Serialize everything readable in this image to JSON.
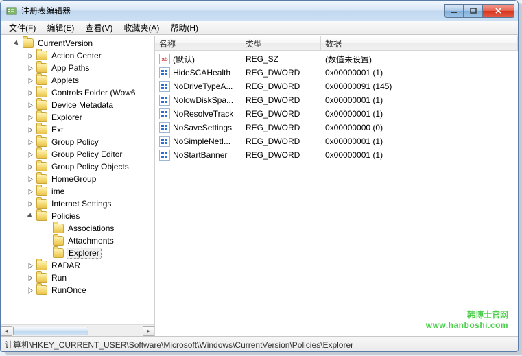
{
  "window": {
    "title": "注册表编辑器"
  },
  "menu": [
    "文件(F)",
    "编辑(E)",
    "查看(V)",
    "收藏夹(A)",
    "帮助(H)"
  ],
  "tree": {
    "root": "CurrentVersion",
    "items": [
      "Action Center",
      "App Paths",
      "Applets",
      "Controls Folder (Wow6",
      "Device Metadata",
      "Explorer",
      "Ext",
      "Group Policy",
      "Group Policy Editor",
      "Group Policy Objects",
      "HomeGroup",
      "ime",
      "Internet Settings"
    ],
    "policies": "Policies",
    "policies_children": [
      "Associations",
      "Attachments",
      "Explorer"
    ],
    "end_items": [
      "RADAR",
      "Run",
      "RunOnce"
    ],
    "selected": "Explorer"
  },
  "columns": {
    "name": "名称",
    "type": "类型",
    "data": "数据"
  },
  "rows": [
    {
      "icon": "ab",
      "name": "(默认)",
      "type": "REG_SZ",
      "data": "(数值未设置)"
    },
    {
      "icon": "dw",
      "name": "HideSCAHealth",
      "type": "REG_DWORD",
      "data": "0x00000001 (1)"
    },
    {
      "icon": "dw",
      "name": "NoDriveTypeA...",
      "type": "REG_DWORD",
      "data": "0x00000091 (145)"
    },
    {
      "icon": "dw",
      "name": "NolowDiskSpa...",
      "type": "REG_DWORD",
      "data": "0x00000001 (1)"
    },
    {
      "icon": "dw",
      "name": "NoResolveTrack",
      "type": "REG_DWORD",
      "data": "0x00000001 (1)"
    },
    {
      "icon": "dw",
      "name": "NoSaveSettings",
      "type": "REG_DWORD",
      "data": "0x00000000 (0)"
    },
    {
      "icon": "dw",
      "name": "NoSimpleNetI...",
      "type": "REG_DWORD",
      "data": "0x00000001 (1)"
    },
    {
      "icon": "dw",
      "name": "NoStartBanner",
      "type": "REG_DWORD",
      "data": "0x00000001 (1)"
    }
  ],
  "watermark": {
    "line1": "韩博士官网",
    "line2": "www.hanboshi.com"
  },
  "status": "计算机\\HKEY_CURRENT_USER\\Software\\Microsoft\\Windows\\CurrentVersion\\Policies\\Explorer"
}
